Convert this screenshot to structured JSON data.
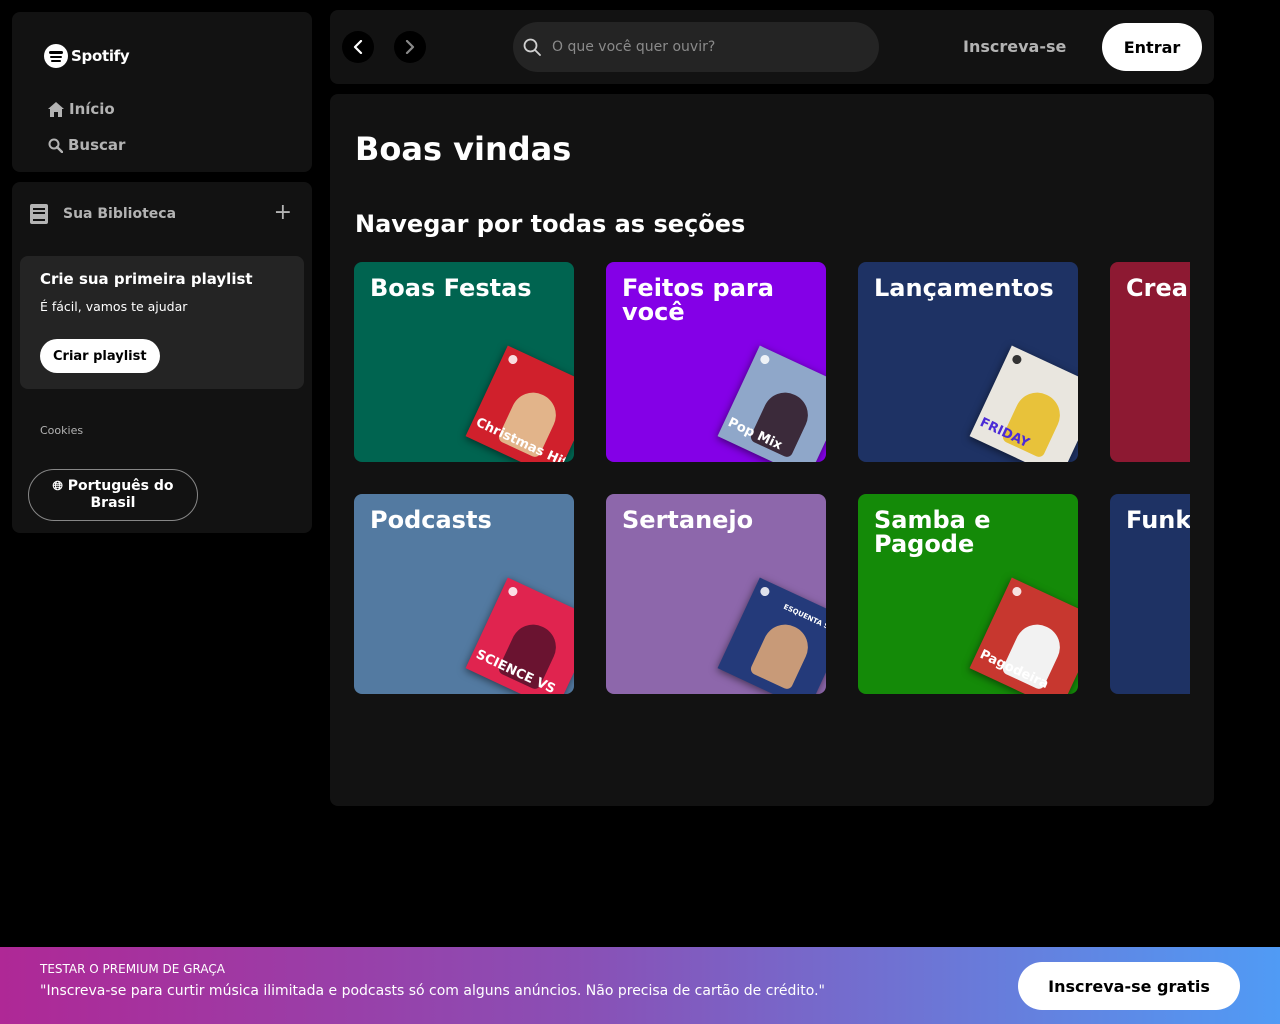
{
  "sidebar": {
    "logo_text": "Spotify",
    "nav": [
      {
        "label": "Início",
        "icon": "home-icon"
      },
      {
        "label": "Buscar",
        "icon": "search-icon"
      }
    ],
    "library": {
      "title": "Sua Biblioteca",
      "add_icon": "plus-icon",
      "promo": {
        "title": "Crie sua primeira playlist",
        "subtitle": "É fácil, vamos te ajudar",
        "button": "Criar playlist"
      },
      "cookies": "Cookies",
      "language_button": "Português do Brasil"
    }
  },
  "topbar": {
    "search_placeholder": "O que você quer ouvir?",
    "signup_label": "Inscreva-se",
    "login_label": "Entrar"
  },
  "main": {
    "welcome": "Boas vindas",
    "section_title": "Navegar por todas as seções",
    "cards": [
      {
        "label": "Boas Festas",
        "color": "#006450",
        "art_color": "#d0202c",
        "art_text": "Christmas Hits"
      },
      {
        "label": "Feitos para você",
        "color": "#8400e7",
        "art_color": "#8fa7c9",
        "art_text": "Pop Mix"
      },
      {
        "label": "Lançamentos",
        "color": "#1e3264",
        "art_color": "#e9e6df",
        "art_text": "FRIDAY"
      },
      {
        "label": "Crea",
        "color": "#8d1932",
        "art_color": "#8d1932",
        "art_text": ""
      },
      {
        "label": "Podcasts",
        "color": "#537aa1",
        "art_color": "#e0244f",
        "art_text": "SCIENCE VS"
      },
      {
        "label": "Sertanejo",
        "color": "#8d67ab",
        "art_color": "#243a7a",
        "art_text": "ESQUENTA SERTANEJO"
      },
      {
        "label": "Samba e Pagode",
        "color": "#148a08",
        "art_color": "#c7372f",
        "art_text": "Pagodeira"
      },
      {
        "label": "Funk",
        "color": "#1e3264",
        "art_color": "#1e3264",
        "art_text": ""
      }
    ]
  },
  "banner": {
    "kicker": "TESTAR O PREMIUM DE GRAÇA",
    "text": "\"Inscreva-se para curtir música ilimitada e podcasts só com alguns anúncios. Não precisa de cartão de crédito.\"",
    "button": "Inscreva-se gratis"
  }
}
